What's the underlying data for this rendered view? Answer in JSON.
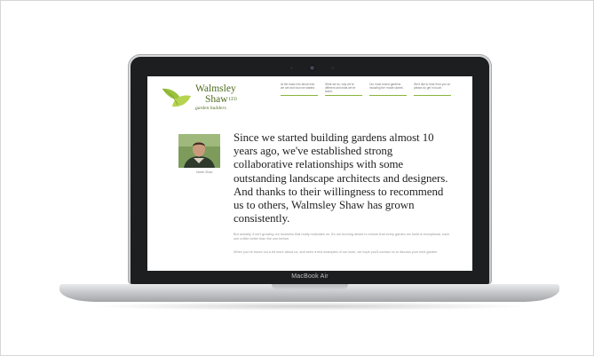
{
  "website": {
    "logo": {
      "line1": "Walmsley",
      "line2": "Shaw",
      "ltd": "LTD",
      "tagline": "garden builders"
    },
    "nav": [
      {
        "label": "At the basic info about who we are and how we started."
      },
      {
        "label": "What we do, why we're different and what we've learnt."
      },
      {
        "label": "Our most recent gardens including the 'made stories'."
      },
      {
        "label": "We'd like to hear from you so please do get in touch."
      }
    ],
    "portrait_caption": "Martin Shaw",
    "headline": "Since we started building gardens almost 10 years ago, we've established strong collaborative relationships with some outstanding landscape architects and designers. And thanks to their willingness to recommend us to others, Walmsley Shaw has grown consistently.",
    "paragraphs": [
      "But actually, it isn't growing our business that really motivates us. It's our burning desire to ensure that every garden we build is exceptional, each one a little better than the one before.",
      "When you've found out a bit more about us, and seen a few examples of our work, we hope you'll contact us to discuss your next garden."
    ]
  },
  "device": {
    "brand_label": "MacBook Air"
  },
  "colors": {
    "accent": "#8ab43a",
    "logo_green": "#4e6b1e"
  }
}
